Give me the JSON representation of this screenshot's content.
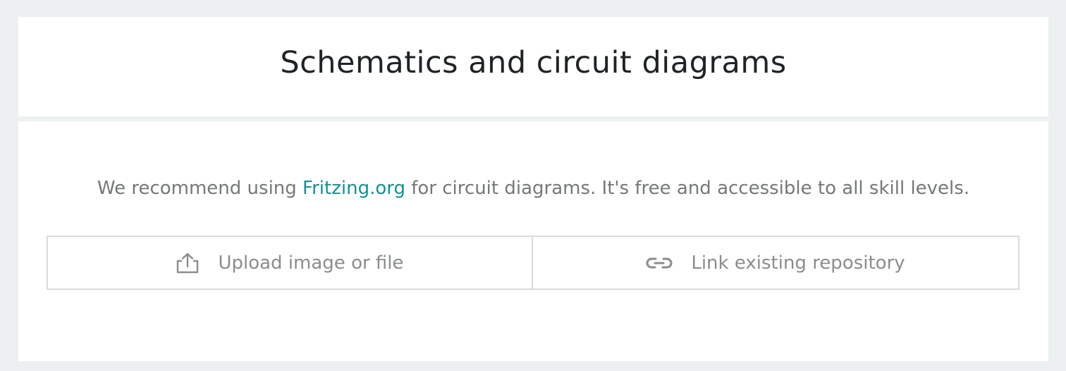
{
  "title": "Schematics and circuit diagrams",
  "recommend": {
    "prefix": "We recommend using ",
    "link_text": "Fritzing.org",
    "suffix": " for circuit diagrams. It's free and accessible to all skill levels."
  },
  "actions": {
    "upload_label": "Upload image or file",
    "upload_icon": "upload-icon",
    "link_label": "Link existing repository",
    "link_icon": "link-icon"
  },
  "colors": {
    "background": "#ecf0f1",
    "card": "#ffffff",
    "title": "#1f2326",
    "body_text": "#75787a",
    "link": "#109292",
    "button_text": "#8a8d8f",
    "border": "#d9dcdd"
  }
}
